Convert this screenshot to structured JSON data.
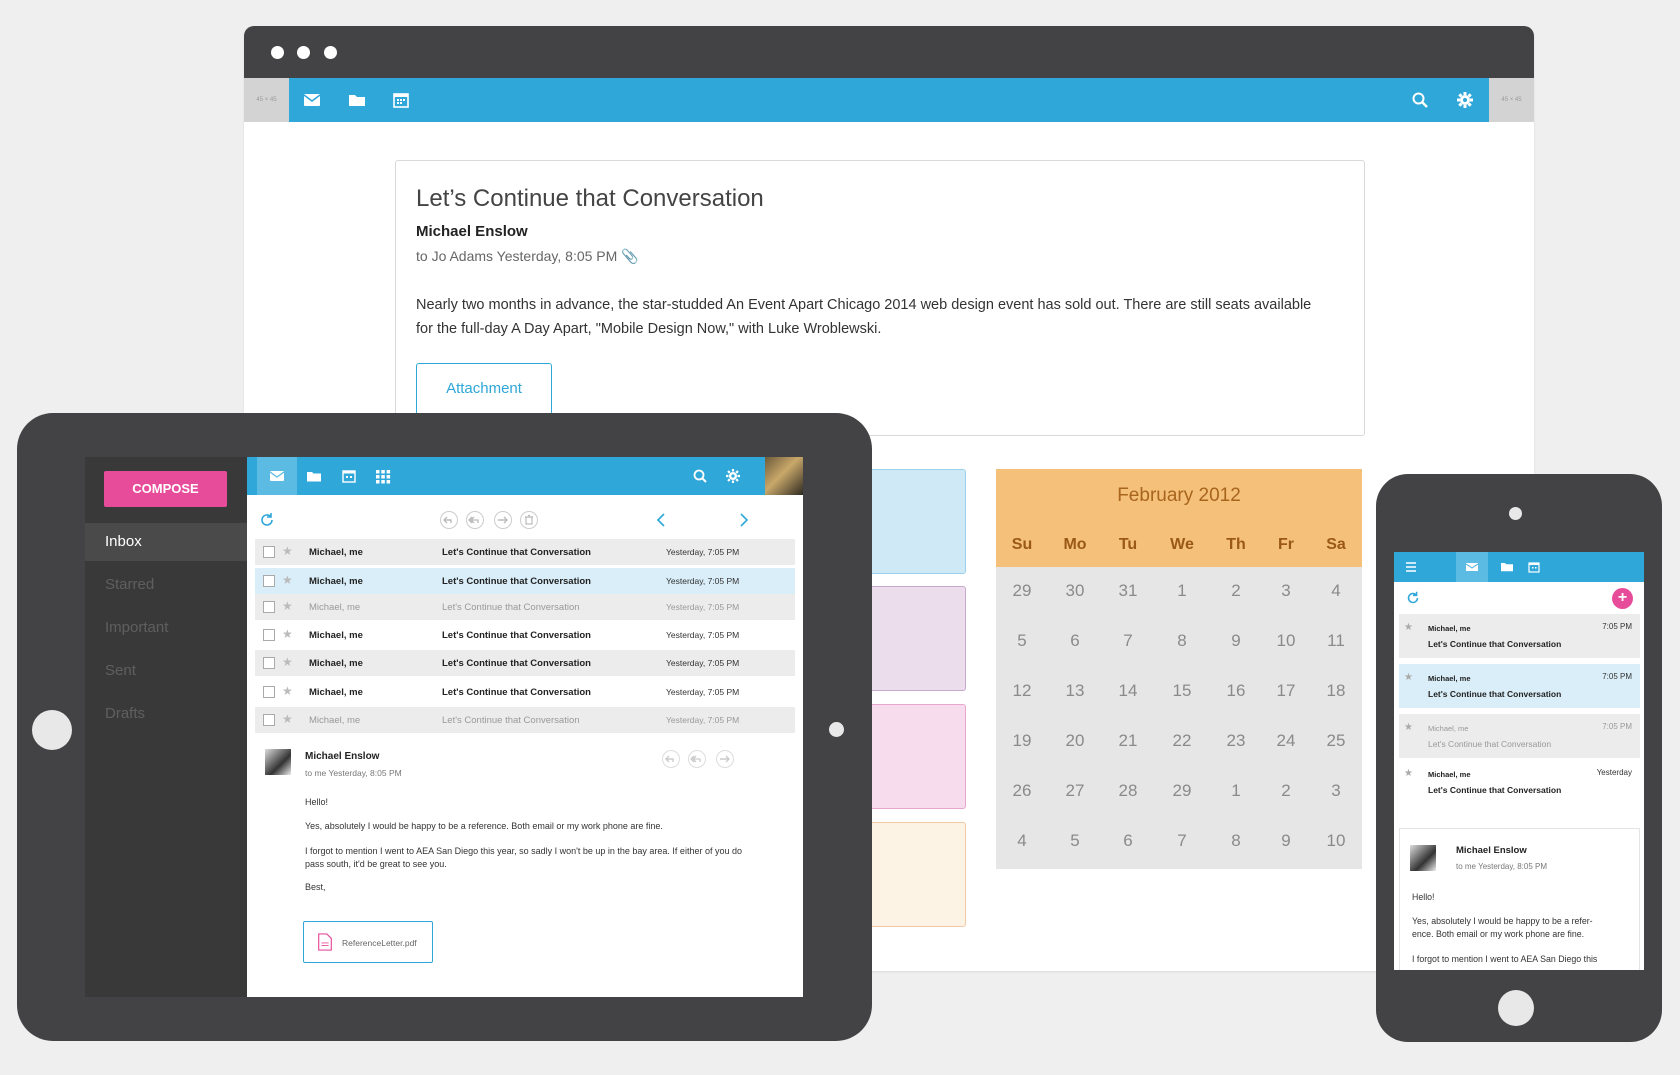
{
  "desktop": {
    "nav_cap_left": "45 × 45",
    "nav_cap_right": "45 × 45",
    "email": {
      "subject": "Let’s Continue that Conversation",
      "sender": "Michael Enslow",
      "meta": "to Jo Adams Yesterday, 8:05 PM",
      "body": "Nearly two months in advance, the star-studded An Event Apart Chicago 2014 web design event has sold out. There are still seats available for the full-day A Day Apart, \"Mobile Design Now,\" with Luke Wroblewski.",
      "attachment_label": "Attachment"
    },
    "calendar": {
      "title": "February 2012",
      "days_of_week": [
        "Su",
        "Mo",
        "Tu",
        "We",
        "Th",
        "Fr",
        "Sa"
      ],
      "weeks": [
        [
          "29",
          "30",
          "31",
          "1",
          "2",
          "3",
          "4"
        ],
        [
          "5",
          "6",
          "7",
          "8",
          "9",
          "10",
          "11"
        ],
        [
          "12",
          "13",
          "14",
          "15",
          "16",
          "17",
          "18"
        ],
        [
          "19",
          "20",
          "21",
          "22",
          "23",
          "24",
          "25"
        ],
        [
          "26",
          "27",
          "28",
          "29",
          "1",
          "2",
          "3"
        ],
        [
          "4",
          "5",
          "6",
          "7",
          "8",
          "9",
          "10"
        ]
      ]
    },
    "colors": {
      "accent": "#2fa7d8",
      "compose": "#e74c9a",
      "calendar_header": "#f4c07a"
    }
  },
  "tablet": {
    "compose_label": "COMPOSE",
    "sidebar": [
      "Inbox",
      "Starred",
      "Important",
      "Sent",
      "Drafts"
    ],
    "mail_list": [
      {
        "from": "Michael, me",
        "subject": "Let's Continue that Conversation",
        "date": "Yesterday, 7:05 PM",
        "read": false
      },
      {
        "from": "Michael, me",
        "subject": "Let's Continue that Conversation",
        "date": "Yesterday, 7:05 PM",
        "read": false
      },
      {
        "from": "Michael, me",
        "subject": "Let's Continue that Conversation",
        "date": "Yesterday, 7:05 PM",
        "read": true
      },
      {
        "from": "Michael, me",
        "subject": "Let's Continue that Conversation",
        "date": "Yesterday, 7:05 PM",
        "read": false
      },
      {
        "from": "Michael, me",
        "subject": "Let's Continue that Conversation",
        "date": "Yesterday, 7:05 PM",
        "read": false
      },
      {
        "from": "Michael, me",
        "subject": "Let's Continue that Conversation",
        "date": "Yesterday, 7:05 PM",
        "read": false
      },
      {
        "from": "Michael, me",
        "subject": "Let's Continue that Conversation",
        "date": "Yesterday, 7:05 PM",
        "read": true
      }
    ],
    "message": {
      "sender": "Michael Enslow",
      "meta": "to me   Yesterday, 8:05 PM",
      "lines": [
        "Hello!",
        "Yes, absolutely I would be happy to be a reference. Both email or my work phone are fine.",
        "I forgot to mention I went to AEA San Diego this year, so sadly I won't be up in the bay area. If either of you do pass south, it'd be great to see you.",
        "Best,"
      ],
      "file_name": "ReferenceLetter.pdf"
    }
  },
  "phone": {
    "list": [
      {
        "from": "Michael, me",
        "subject": "Let's Continue that Conversation",
        "time": "7:05 PM",
        "read": false
      },
      {
        "from": "Michael, me",
        "subject": "Let's Continue that Conversation",
        "time": "7:05 PM",
        "read": false
      },
      {
        "from": "Michael, me",
        "subject": "Let's Continue that Conversation",
        "time": "7:05 PM",
        "read": true
      },
      {
        "from": "Michael, me",
        "subject": "Let's Continue that Conversation",
        "time": "Yesterday",
        "read": false
      }
    ],
    "message": {
      "sender": "Michael Enslow",
      "meta": "to me   Yesterday, 8:05 PM",
      "lines": [
        "Hello!",
        "Yes, absolutely I would be happy to be a refer-",
        "ence. Both email or my work phone are fine.",
        "I forgot to mention I went to AEA San Diego this"
      ]
    }
  }
}
